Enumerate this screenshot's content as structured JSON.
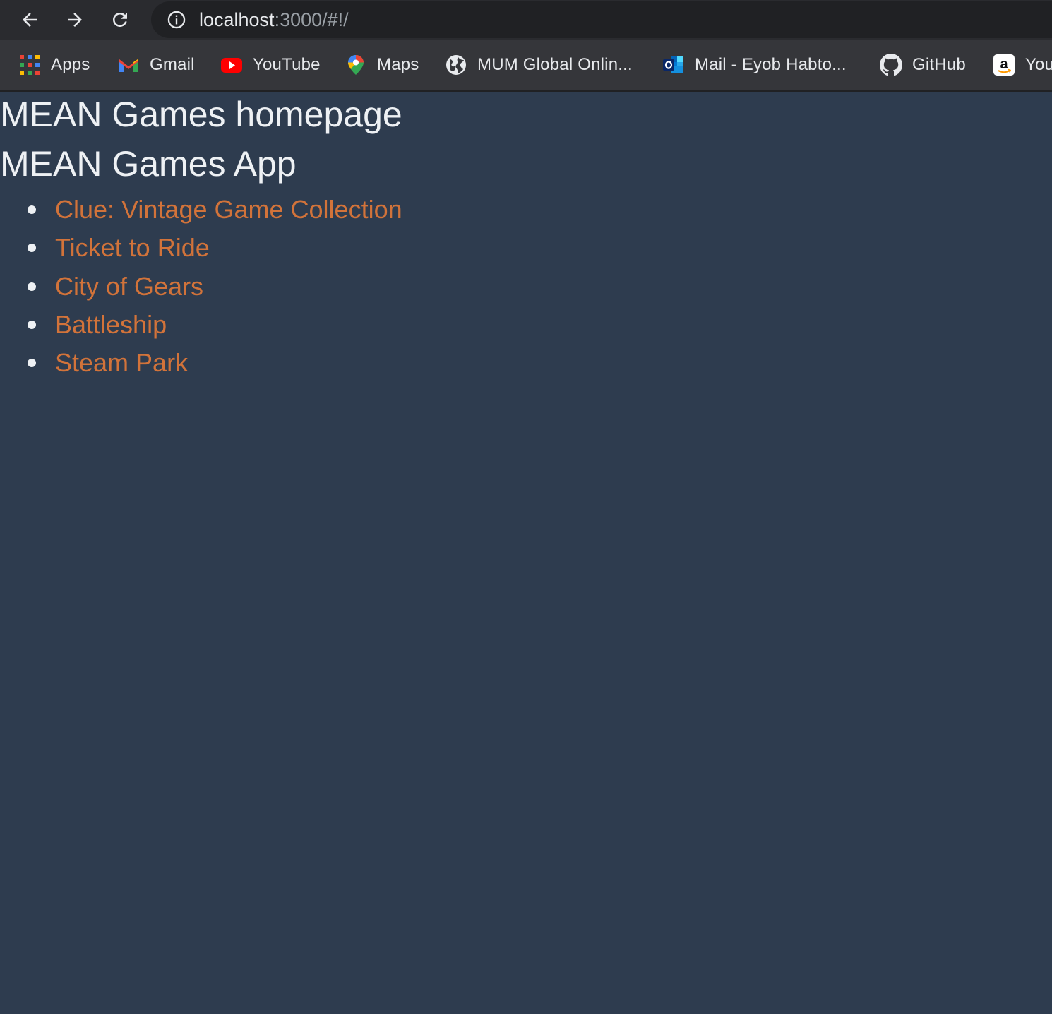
{
  "browser": {
    "url_host": "localhost",
    "url_rest": ":3000/#!/",
    "bookmarks": [
      {
        "label": "Apps",
        "icon": "apps-grid-icon"
      },
      {
        "label": "Gmail",
        "icon": "gmail-icon"
      },
      {
        "label": "YouTube",
        "icon": "youtube-icon"
      },
      {
        "label": "Maps",
        "icon": "maps-pin-icon"
      },
      {
        "label": "MUM Global Onlin...",
        "icon": "globe-icon"
      },
      {
        "label": "Mail - Eyob Habto...",
        "icon": "outlook-icon"
      },
      {
        "label": "GitHub",
        "icon": "github-icon"
      },
      {
        "label": "You",
        "icon": "amazon-icon"
      }
    ]
  },
  "page": {
    "title": "MEAN Games homepage",
    "app_title": "MEAN Games App",
    "games": [
      "Clue: Vintage Game Collection",
      "Ticket to Ride",
      "City of Gears",
      "Battleship",
      "Steam Park"
    ]
  },
  "colors": {
    "background": "#2e3c4f",
    "heading_text": "#eef1f4",
    "link": "#d2733a",
    "toolbar": "#2a2b2f",
    "bookmarks_bar": "#35363a"
  }
}
